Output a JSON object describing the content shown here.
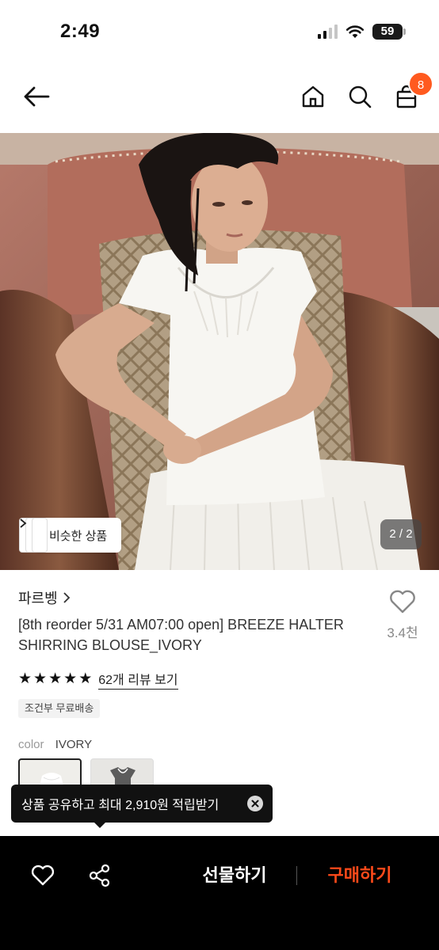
{
  "status": {
    "time": "2:49",
    "battery": "59"
  },
  "header": {
    "back_icon": "arrow-left-icon",
    "home_icon": "home-icon",
    "search_icon": "search-icon",
    "bag_icon": "shopping-bag-icon",
    "bag_count": "8",
    "badge_color": "#ff5a1f"
  },
  "gallery": {
    "similar_label": "비슷한 상품",
    "page_indicator": "2 / 2"
  },
  "product": {
    "brand": "파르벵",
    "title": "[8th reorder 5/31 AM07:00 open] BREEZE HALTER SHIRRING BLOUSE_IVORY",
    "like_count": "3.4천",
    "rating_stars": 5,
    "review_link": "62개 리뷰 보기",
    "shipping_chip": "조건부 무료배송",
    "color_label": "color",
    "color_value": "IVORY"
  },
  "tooltip": {
    "text": "상품 공유하고 최대 2,910원 적립받기"
  },
  "bottom_bar": {
    "gift_label": "선물하기",
    "buy_label": "구매하기",
    "buy_color": "#ff4a1a"
  }
}
